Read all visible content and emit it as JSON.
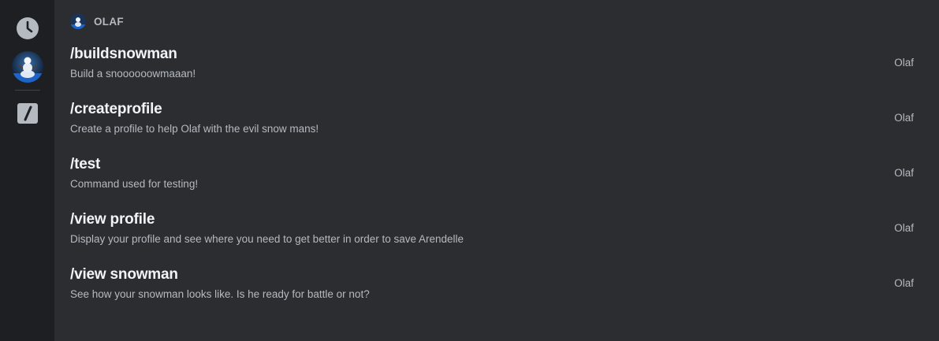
{
  "rail": {
    "items": [
      {
        "icon": "clock-icon"
      },
      {
        "icon": "olaf-avatar"
      },
      {
        "icon": "slash-command-icon"
      }
    ]
  },
  "section": {
    "title": "OLAF"
  },
  "commands": [
    {
      "name": "/buildsnowman",
      "description": "Build a snoooooowmaaan!",
      "app": "Olaf"
    },
    {
      "name": "/createprofile",
      "description": "Create a profile to help Olaf with the evil snow mans!",
      "app": "Olaf"
    },
    {
      "name": "/test",
      "description": "Command used for testing!",
      "app": "Olaf"
    },
    {
      "name": "/view profile",
      "description": "Display your profile and see where you need to get better in order to save Arendelle",
      "app": "Olaf"
    },
    {
      "name": "/view snowman",
      "description": "See how your snowman looks like. Is he ready for battle or not?",
      "app": "Olaf"
    }
  ],
  "colors": {
    "rail_bg": "#1e1f22",
    "main_bg": "#2b2d31",
    "text_primary": "#f2f3f5",
    "text_secondary": "#b5bac1"
  }
}
